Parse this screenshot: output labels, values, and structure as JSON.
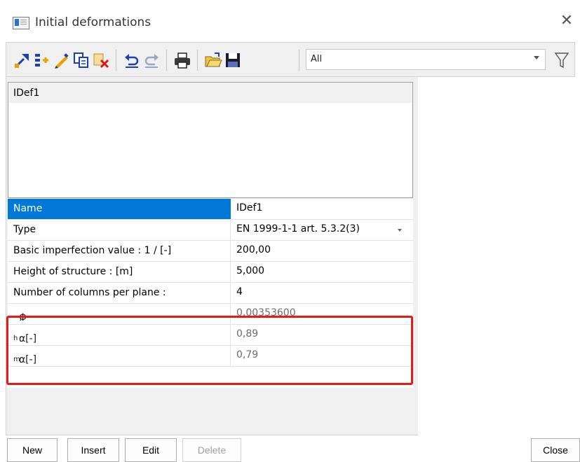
{
  "window": {
    "title": "Initial deformations"
  },
  "toolbar": {
    "buttons": [
      {
        "icon": "new-item-icon"
      },
      {
        "icon": "insert-icon"
      },
      {
        "icon": "edit-icon"
      },
      {
        "icon": "copy-icon"
      },
      {
        "icon": "delete-icon"
      },
      {
        "icon": "undo-icon"
      },
      {
        "icon": "redo-icon"
      },
      {
        "icon": "print-icon"
      },
      {
        "icon": "open-folder-icon"
      },
      {
        "icon": "save-icon"
      }
    ],
    "filter_value": "All",
    "filter_icon": "funnel-icon"
  },
  "list": {
    "items": [
      "IDef1"
    ]
  },
  "properties": {
    "rows": [
      {
        "label": "Name",
        "value": "IDef1"
      },
      {
        "label": "Type",
        "value": "EN 1999-1-1 art. 5.3.2(3)"
      },
      {
        "label": "Basic imperfection value : 1 / [-]",
        "value": "200,00"
      },
      {
        "label": "Height of structure : [m]",
        "value": "5,000"
      },
      {
        "label": "Number of columns per plane :",
        "value": "4"
      },
      {
        "label_symbol": "Φ",
        "label_sub": "",
        "label_suffix": " :",
        "value": "0,00353600"
      },
      {
        "label_symbol": "α",
        "label_sub": "h",
        "label_suffix": " : [-]",
        "value": "0,89"
      },
      {
        "label_symbol": "α",
        "label_sub": "m",
        "label_suffix": " : [-]",
        "value": "0,79"
      }
    ]
  },
  "buttons": {
    "new": "New",
    "insert": "Insert",
    "edit": "Edit",
    "delete": "Delete",
    "close": "Close"
  },
  "colors": {
    "selection": "#0078d7",
    "highlight_border": "#e21c1c"
  }
}
